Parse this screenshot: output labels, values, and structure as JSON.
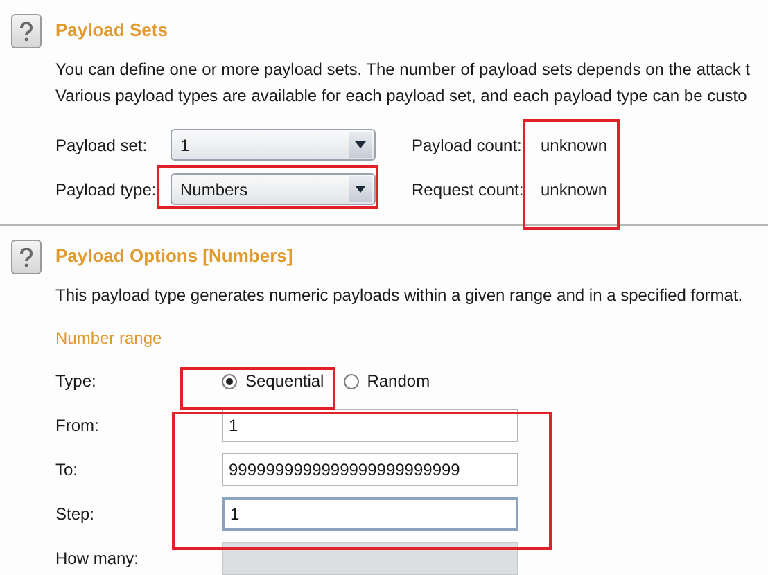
{
  "sections": [
    {
      "title": "Payload Sets",
      "description": [
        "You can define one or more payload sets. The number of payload sets depends on the attack t",
        "Various payload types are available for each payload set, and each payload type can be custo"
      ],
      "settings": [
        {
          "label": "Payload set:",
          "value": "1",
          "info_label": "Payload count:",
          "info_value": "unknown"
        },
        {
          "label": "Payload type:",
          "value": "Numbers",
          "info_label": "Request count:",
          "info_value": "unknown"
        }
      ]
    },
    {
      "title": "Payload Options [Numbers]",
      "description": [
        "This payload type generates numeric payloads within a given range and in a specified format."
      ],
      "group": "Number range",
      "type": {
        "label": "Type:",
        "options": [
          {
            "label": "Sequential",
            "selected": true
          },
          {
            "label": "Random",
            "selected": false
          }
        ]
      },
      "fields": [
        {
          "label": "From:",
          "value": "1",
          "focused": false,
          "disabled": false
        },
        {
          "label": "To:",
          "value": "9999999999999999999999999",
          "focused": false,
          "disabled": false
        },
        {
          "label": "Step:",
          "value": "1",
          "focused": true,
          "disabled": false
        },
        {
          "label": "How many:",
          "focused": false,
          "disabled": true
        }
      ]
    }
  ]
}
